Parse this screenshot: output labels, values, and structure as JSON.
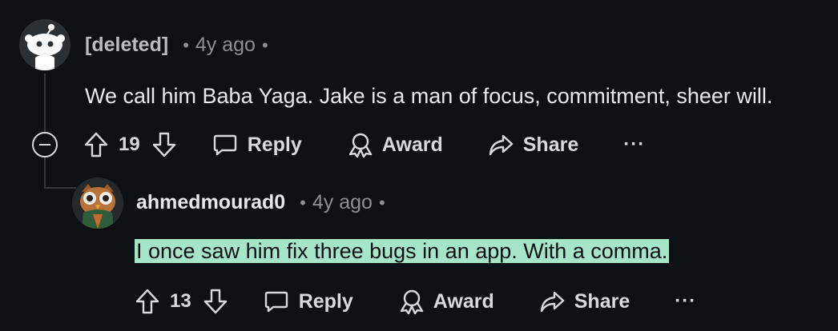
{
  "comments": [
    {
      "author": "[deleted]",
      "separator": "•",
      "time": "4y ago",
      "time_dot": "•",
      "body": "We call him Baba Yaga. Jake is a man of focus, commitment, sheer will.",
      "score": "19",
      "actions": {
        "reply": "Reply",
        "award": "Award",
        "share": "Share",
        "more": "···"
      },
      "avatar_icon": "snoo-deleted-avatar"
    },
    {
      "author": "ahmedmourad0",
      "separator": "•",
      "time": "4y ago",
      "time_dot": "•",
      "body": "I once saw him fix three bugs in an app. With a comma.",
      "score": "13",
      "actions": {
        "reply": "Reply",
        "award": "Award",
        "share": "Share",
        "more": "···"
      },
      "avatar_icon": "owl-avatar",
      "highlight_color": "#a6e5c8"
    }
  ],
  "colors": {
    "background": "#0e1113",
    "text": "#d7dadc",
    "muted": "#8a9093",
    "thread_line": "#33393d"
  }
}
